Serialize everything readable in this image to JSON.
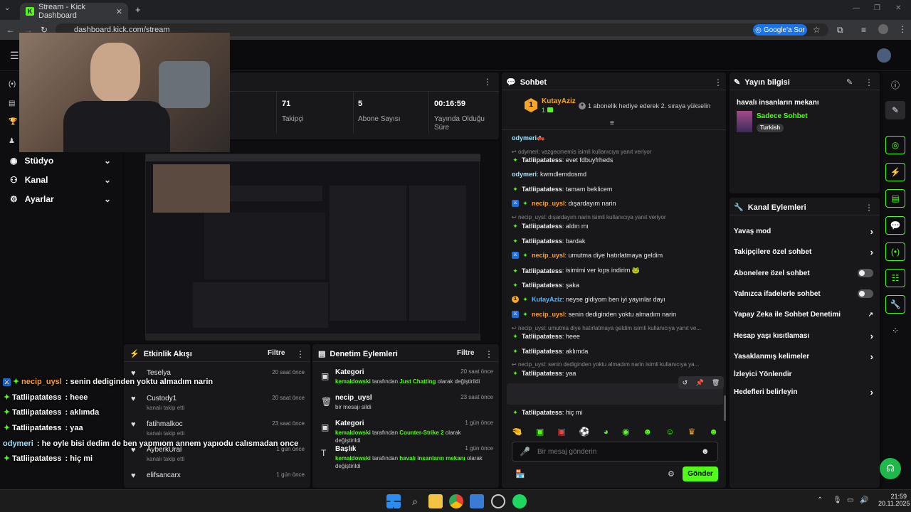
{
  "browser": {
    "tab_title": "Stream - Kick Dashboard",
    "url": "dashboard.kick.com/stream",
    "google_btn": "Google'a Sor"
  },
  "nav": {
    "items": [
      {
        "label": "Stüdyo"
      },
      {
        "label": "Kanal"
      },
      {
        "label": "Ayarlar"
      }
    ]
  },
  "stats": [
    {
      "value": "71",
      "label": "Takipçi"
    },
    {
      "value": "5",
      "label": "Abone Sayısı"
    },
    {
      "value": "00:16:59",
      "label": "Yayında Olduğu Süre"
    }
  ],
  "activity": {
    "title": "Etkinlik Akışı",
    "filter": "Filtre",
    "items": [
      {
        "name": "Teselya",
        "sub": "",
        "time": "20 saat önce"
      },
      {
        "name": "Custody1",
        "sub": "kanalı takip etti",
        "time": "20 saat önce"
      },
      {
        "name": "fatihmalkoc",
        "sub": "kanalı takip etti",
        "time": "23 saat önce"
      },
      {
        "name": "AyberkUral",
        "sub": "kanalı takip etti",
        "time": "1 gün önce"
      },
      {
        "name": "elifsancarx",
        "sub": "",
        "time": "1 gün önce"
      }
    ]
  },
  "moderation": {
    "title": "Denetim Eylemleri",
    "filter": "Filtre",
    "items": [
      {
        "title": "Kategori",
        "time": "20 saat önce",
        "user": "kemaldowski",
        "mid": " tarafından ",
        "value": "Just Chatting",
        "tail": " olarak değiştirildi",
        "tail2": ""
      },
      {
        "title": "necip_uysl",
        "time": "23 saat önce",
        "user": "",
        "mid": "bir mesajı sildi",
        "value": "",
        "tail": "",
        "tail2": ""
      },
      {
        "title": "Kategori",
        "time": "1 gün önce",
        "user": "kemaldowski",
        "mid": " tarafından ",
        "value": "Counter-Strike 2",
        "tail": " olarak",
        "tail2": "değiştirildi"
      },
      {
        "title": "Başlık",
        "time": "1 gün önce",
        "user": "kemaldowski",
        "mid": " tarafından ",
        "value": "havalı insanların mekanı",
        "tail": " olarak",
        "tail2": "değiştirildi"
      }
    ]
  },
  "chat": {
    "title": "Sohbet",
    "pinned_user": "KutayAziz",
    "pinned_rank": "1",
    "pinned_count": "1",
    "pinned_msg": "1 abonelik hediye ederek 2. sıraya yükselin",
    "messages": [
      {
        "type": "msg",
        "user": "odymeri",
        "color": "#9fe3ff",
        "text": " 🛻",
        "badges": ""
      },
      {
        "type": "reply",
        "text": "odymeri: vazgecmemis isimli kullanıcıya yanıt veriyor"
      },
      {
        "type": "msg",
        "user": "Tatliipatatess",
        "color": "#f0f0f0",
        "text": ": evet fdbuyfrheds",
        "badges": "sub"
      },
      {
        "type": "msg",
        "user": "odymeri",
        "color": "#9fe3ff",
        "text": ": kwmdlemdosmd",
        "badges": ""
      },
      {
        "type": "msg",
        "user": "Tatliipatatess",
        "color": "#f0f0f0",
        "text": ": tamam beklicem",
        "badges": "sub"
      },
      {
        "type": "msg",
        "user": "necip_uysl",
        "color": "#ff9f2e",
        "text": ": dışardayım narin",
        "badges": "mod sub"
      },
      {
        "type": "reply",
        "text": "necip_uysl: dışardayım narin isimli kullanıcıya yanıt veriyor"
      },
      {
        "type": "msg",
        "user": "Tatliipatatess",
        "color": "#f0f0f0",
        "text": ": aldın mı",
        "badges": "sub"
      },
      {
        "type": "msg",
        "user": "Tatliipatatess",
        "color": "#f0f0f0",
        "text": ": bardak",
        "badges": "sub"
      },
      {
        "type": "msg",
        "user": "necip_uysl",
        "color": "#ff9f2e",
        "text": ": umutma diye hatırlatmaya geldim",
        "badges": "mod sub"
      },
      {
        "type": "msg",
        "user": "Tatliipatatess",
        "color": "#f0f0f0",
        "text": ": isimimi ver kıps indirim 🐸",
        "badges": "sub"
      },
      {
        "type": "msg",
        "user": "Tatliipatatess",
        "color": "#f0f0f0",
        "text": ": şaka",
        "badges": "sub"
      },
      {
        "type": "msg",
        "user": "KutayAziz",
        "color": "#55b6ff",
        "text": ": neyse gidiyom ben iyi yayınlar dayı",
        "badges": "gift sub"
      },
      {
        "type": "msg",
        "user": "necip_uysl",
        "color": "#ff9f2e",
        "text": ": senin dediginden yoktu almadım narin",
        "badges": "mod sub"
      },
      {
        "type": "reply",
        "text": "necip_uysl: umutma diye hatırlatmaya geldim isimli kullanıcıya yanıt ve..."
      },
      {
        "type": "msg",
        "user": "Tatliipatatess",
        "color": "#f0f0f0",
        "text": ": heee",
        "badges": "sub"
      },
      {
        "type": "msg",
        "user": "Tatliipatatess",
        "color": "#f0f0f0",
        "text": ": aklımda",
        "badges": "sub"
      },
      {
        "type": "reply",
        "text": "necip_uysl: senin dediginden yoktu almadım narin isimli kullanıcıya ya..."
      },
      {
        "type": "msg",
        "user": "Tatliipatatess",
        "color": "#f0f0f0",
        "text": ": yaa",
        "badges": "sub"
      },
      {
        "type": "msg2",
        "user": "odymeri",
        "color": "#9fe3ff",
        "text": ": he oyle bisi dedim de ben yapmıom annem yapıodu",
        "text2": "calısmadan once",
        "badges": ""
      },
      {
        "type": "msg",
        "user": "Tatliipatatess",
        "color": "#f0f0f0",
        "text": ": hiç mi",
        "badges": "sub"
      }
    ],
    "input_placeholder": "Bir mesaj gönderin",
    "send_label": "Gönder"
  },
  "stream_info": {
    "title": "Yayın bilgisi",
    "stream_title": "havalı insanların mekanı",
    "category": "Sadece Sohbet",
    "tag": "Turkish"
  },
  "channel_actions": {
    "title": "Kanal Eylemleri",
    "items": [
      {
        "label": "Yavaş mod",
        "kind": "chevron"
      },
      {
        "label": "Takipçilere özel sohbet",
        "kind": "chevron"
      },
      {
        "label": "Abonelere özel sohbet",
        "kind": "toggle"
      },
      {
        "label": "Yalnızca ifadelerle sohbet",
        "kind": "toggle"
      },
      {
        "label": "Yapay Zeka ile Sohbet Denetimi",
        "kind": "external"
      },
      {
        "label": "Hesap yaşı kısıtlaması",
        "kind": "chevron"
      },
      {
        "label": "Yasaklanmış kelimeler",
        "kind": "chevron"
      },
      {
        "label": "İzleyici Yönlendir",
        "kind": "none"
      },
      {
        "label": "Hedefleri belirleyin",
        "kind": "chevron"
      }
    ]
  },
  "overlay_chat": [
    {
      "user": "necip_uysl",
      "color": "#ff9f2e",
      "text": " : senin dediginden yoktu almadım narin",
      "badges": "mod sub"
    },
    {
      "user": "Tatliipatatess",
      "color": "#ffffff",
      "text": " : heee",
      "badges": "sub"
    },
    {
      "user": "Tatliipatatess",
      "color": "#ffffff",
      "text": " : aklımda",
      "badges": "sub"
    },
    {
      "user": "Tatliipatatess",
      "color": "#ffffff",
      "text": " : yaa",
      "badges": "sub"
    },
    {
      "user": "odymeri",
      "color": "#9fe3ff",
      "text": " : he oyle bisi dedim de ben yapmıom annem yapıodu calısmadan once",
      "badges": ""
    },
    {
      "user": "Tatliipatatess",
      "color": "#ffffff",
      "text": " : hiç mi",
      "badges": "sub"
    }
  ],
  "taskbar": {
    "time": "21:59",
    "date": "20.11.2025"
  },
  "colors": {
    "accent": "#53fc18",
    "panel": "#18181b",
    "background": "#0b0b0d"
  }
}
